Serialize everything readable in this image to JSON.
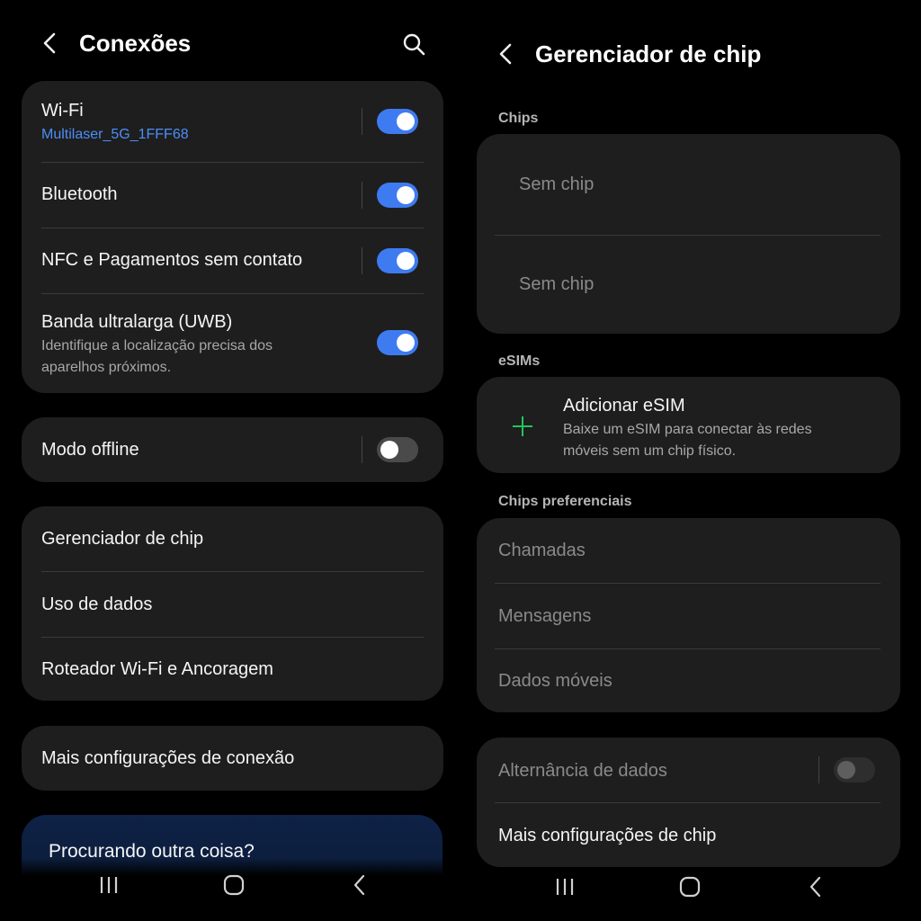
{
  "colors": {
    "background": "#000000",
    "card": "#1e1e1e",
    "accent": "#3e7bf1",
    "link": "#4d8ef7",
    "add_icon": "#22c55e"
  },
  "left": {
    "header": {
      "title": "Conexões",
      "back_icon": "chevron-left-icon",
      "search_icon": "search-icon"
    },
    "wireless_card": {
      "wifi": {
        "label": "Wi-Fi",
        "network": "Multilaser_5G_1FFF68",
        "enabled": true
      },
      "bluetooth": {
        "label": "Bluetooth",
        "enabled": true
      },
      "nfc": {
        "label": "NFC e Pagamentos sem contato",
        "enabled": true
      },
      "uwb": {
        "label": "Banda ultralarga (UWB)",
        "description": "Identifique a localização precisa dos aparelhos próximos.",
        "enabled": true
      }
    },
    "offline_card": {
      "label": "Modo offline",
      "enabled": false
    },
    "network_card": {
      "items": [
        {
          "label": "Gerenciador de chip"
        },
        {
          "label": "Uso de dados"
        },
        {
          "label": "Roteador Wi-Fi e Ancoragem"
        }
      ]
    },
    "more_card": {
      "label": "Mais configurações de conexão"
    },
    "looking_card": {
      "label": "Procurando outra coisa?"
    }
  },
  "right": {
    "header": {
      "title": "Gerenciador de chip",
      "back_icon": "chevron-left-icon"
    },
    "chips_section": {
      "title": "Chips",
      "items": [
        {
          "label": "Sem chip"
        },
        {
          "label": "Sem chip"
        }
      ]
    },
    "esims_section": {
      "title": "eSIMs",
      "add": {
        "icon": "plus-icon",
        "label": "Adicionar eSIM",
        "description": "Baixe um eSIM para conectar às redes móveis sem um chip físico."
      }
    },
    "preferred_section": {
      "title": "Chips preferenciais",
      "items": [
        {
          "label": "Chamadas"
        },
        {
          "label": "Mensagens"
        },
        {
          "label": "Dados móveis"
        }
      ]
    },
    "bottom_card": {
      "data_switch": {
        "label": "Alternância de dados",
        "enabled": false
      },
      "more": {
        "label": "Mais configurações de chip"
      }
    }
  },
  "navbar": {
    "recent_icon": "recent-apps-icon",
    "home_icon": "home-icon",
    "back_icon": "back-icon"
  }
}
